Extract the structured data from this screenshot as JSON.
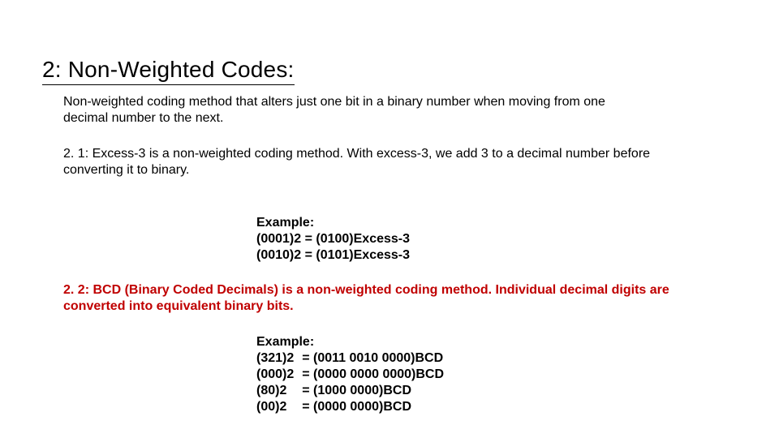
{
  "heading": "2: Non-Weighted Codes:",
  "intro": "Non-weighted coding method that alters just one bit in a binary number when moving from one decimal number to the next.",
  "sub1": "2. 1: Excess-3 is a non-weighted coding method. With excess-3, we add 3 to a decimal number before converting it to binary.",
  "example1": {
    "title": "Example:",
    "line1": "(0001)2 = (0100)Excess-3",
    "line2": "(0010)2 = (0101)Excess-3"
  },
  "sub2": "2. 2: BCD (Binary Coded Decimals)  is a non-weighted coding method. Individual decimal digits are converted into equivalent binary bits.",
  "example2": {
    "title": "Example:",
    "rows": [
      {
        "lhs": "(321)2",
        "rhs": "= (0011 0010 0000)BCD"
      },
      {
        "lhs": "(000)2",
        "rhs": "= (0000 0000 0000)BCD"
      },
      {
        "lhs": "(80)2",
        "rhs": "= (1000 0000)BCD"
      },
      {
        "lhs": "(00)2",
        "rhs": "= (0000 0000)BCD"
      }
    ]
  }
}
